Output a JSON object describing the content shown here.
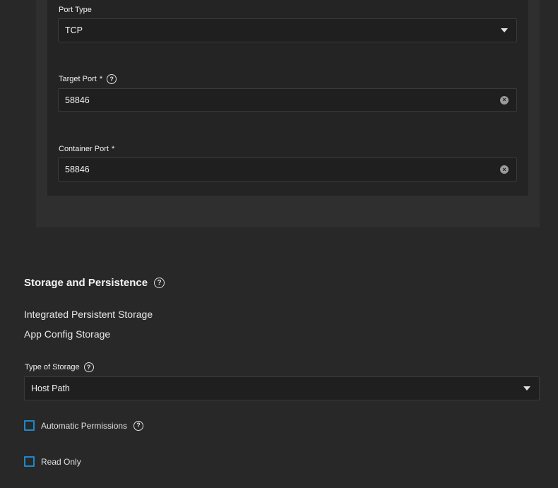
{
  "port": {
    "port_type": {
      "label": "Port Type",
      "value": "TCP"
    },
    "target_port": {
      "label": "Target Port",
      "required_mark": "*",
      "value": "58846"
    },
    "container_port": {
      "label": "Container Port",
      "required_mark": "*",
      "value": "58846"
    }
  },
  "storage": {
    "title": "Storage and Persistence",
    "integrated_label": "Integrated Persistent Storage",
    "app_config_label": "App Config Storage",
    "type_of_storage": {
      "label": "Type of Storage",
      "value": "Host Path"
    },
    "automatic_permissions": {
      "label": "Automatic Permissions",
      "checked": false
    },
    "read_only": {
      "label": "Read Only",
      "checked": false
    }
  },
  "icons": {
    "help": "?",
    "clear": "×"
  },
  "colors": {
    "background": "#282828",
    "field_background": "#1f1f1f",
    "checkbox_accent": "#1e88c8"
  }
}
